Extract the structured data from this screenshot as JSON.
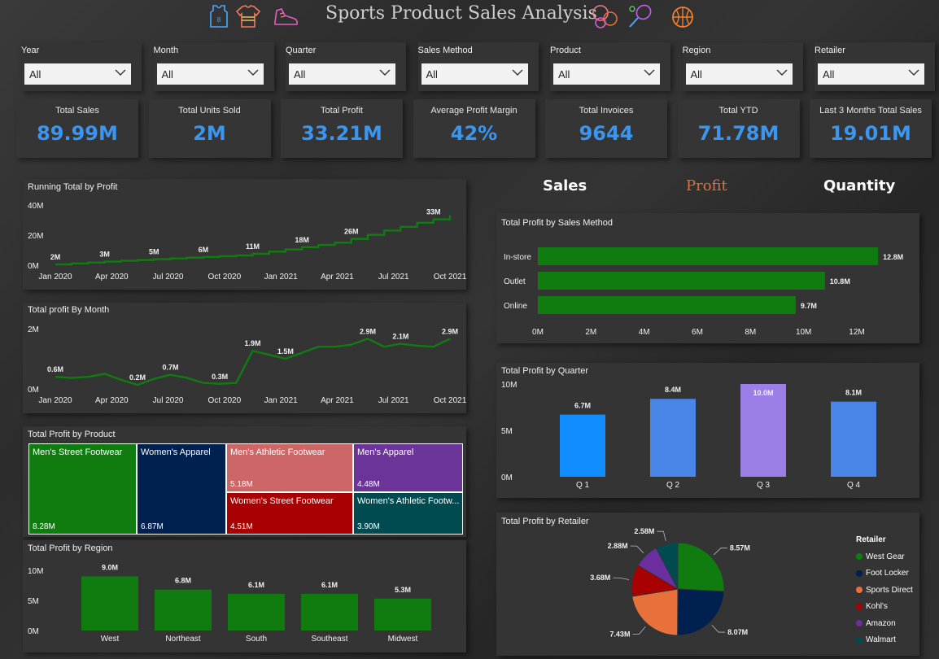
{
  "header": {
    "title": "Sports Product Sales Analysis",
    "icons": [
      "jersey-icon",
      "shirt-icon",
      "sneaker-icon",
      "sports-balls-icon",
      "tennis-racket-icon",
      "basketball-icon"
    ]
  },
  "slicers": [
    {
      "label": "Year",
      "value": "All"
    },
    {
      "label": "Month",
      "value": "All"
    },
    {
      "label": "Quarter",
      "value": "All"
    },
    {
      "label": "Sales Method",
      "value": "All"
    },
    {
      "label": "Product",
      "value": "All"
    },
    {
      "label": "Region",
      "value": "All"
    },
    {
      "label": "Retailer",
      "value": "All"
    }
  ],
  "kpis": [
    {
      "title": "Total Sales",
      "value": "89.99M"
    },
    {
      "title": "Total Units Sold",
      "value": "2M"
    },
    {
      "title": "Total Profit",
      "value": "33.21M"
    },
    {
      "title": "Average Profit Margin",
      "value": "42%"
    },
    {
      "title": "Total Invoices",
      "value": "9644"
    },
    {
      "title": "Total YTD",
      "value": "71.78M"
    },
    {
      "title": "Last 3 Months Total Sales",
      "value": "19.01M"
    }
  ],
  "tabs": {
    "sales": "Sales",
    "profit": "Profit",
    "quantity": "Quantity"
  },
  "colors": {
    "kpi_value": "#3a96f0",
    "green": "#107c10",
    "accent_profit": "#e0703a"
  },
  "chart_data": [
    {
      "id": "running",
      "type": "line",
      "title": "Running Total by Profit",
      "x_ticks": [
        "Jan 2020",
        "Apr 2020",
        "Jul 2020",
        "Oct 2020",
        "Jan 2021",
        "Apr 2021",
        "Jul 2021",
        "Oct 2021"
      ],
      "y_ticks": [
        "0M",
        "20M",
        "40M"
      ],
      "ylim": [
        0,
        40
      ],
      "values": [
        0.6,
        1.2,
        1.8,
        2.4,
        3,
        3.5,
        4,
        4.5,
        5,
        5.5,
        6,
        6.5,
        7.6,
        9,
        10.5,
        12,
        13.5,
        15,
        17.5,
        20.2,
        23,
        25.5,
        28.2,
        30.5,
        33.21
      ],
      "labels": [
        {
          "i": 0,
          "text": "2M"
        },
        {
          "i": 3,
          "text": "3M"
        },
        {
          "i": 6,
          "text": "5M"
        },
        {
          "i": 9,
          "text": "6M"
        },
        {
          "i": 12,
          "text": "11M"
        },
        {
          "i": 15,
          "text": "18M"
        },
        {
          "i": 18,
          "text": "26M"
        },
        {
          "i": 23,
          "text": "33M"
        }
      ]
    },
    {
      "id": "monthly",
      "type": "line",
      "title": "Total profit By Month",
      "x_ticks": [
        "Jan 2020",
        "Apr 2020",
        "Jul 2020",
        "Oct 2020",
        "Jan 2021",
        "Apr 2021",
        "Jul 2021",
        "Oct 2021"
      ],
      "y_ticks": [
        "0M",
        "2M"
      ],
      "ylim": [
        0,
        3
      ],
      "values": [
        0.6,
        0.55,
        0.6,
        0.75,
        0.45,
        0.2,
        0.5,
        0.7,
        0.55,
        0.3,
        0.25,
        0.3,
        1.9,
        1.7,
        1.5,
        1.8,
        2.1,
        2.1,
        2.2,
        2.5,
        2.1,
        2.25,
        2.15,
        2.1,
        2.5
      ],
      "labels": [
        {
          "i": 0,
          "text": "0.6M"
        },
        {
          "i": 5,
          "text": "0.2M"
        },
        {
          "i": 7,
          "text": "0.7M"
        },
        {
          "i": 10,
          "text": "0.3M"
        },
        {
          "i": 12,
          "text": "1.9M"
        },
        {
          "i": 14,
          "text": "1.5M"
        },
        {
          "i": 19,
          "text": "2.9M"
        },
        {
          "i": 21,
          "text": "2.1M"
        },
        {
          "i": 24,
          "text": "2.9M"
        }
      ]
    },
    {
      "id": "method",
      "type": "bar",
      "title": "Total Profit by Sales Method",
      "categories": [
        "In-store",
        "Outlet",
        "Online"
      ],
      "values": [
        12.8,
        10.8,
        9.7
      ],
      "data_labels": [
        "12.8M",
        "10.8M",
        "9.7M"
      ],
      "x_ticks": [
        "0M",
        "2M",
        "4M",
        "6M",
        "8M",
        "10M",
        "12M"
      ],
      "xlim": [
        0,
        12
      ]
    },
    {
      "id": "quarter",
      "type": "bar",
      "title": "Total Profit by Quarter",
      "categories": [
        "Q 1",
        "Q 2",
        "Q 3",
        "Q 4"
      ],
      "values": [
        6.7,
        8.4,
        10.0,
        8.1
      ],
      "data_labels": [
        "6.7M",
        "8.4M",
        "10.0M",
        "8.1M"
      ],
      "colors": [
        "#118dff",
        "#4a86e8",
        "#9b7fe6",
        "#4a86e8"
      ],
      "y_ticks": [
        "0M",
        "5M",
        "10M"
      ],
      "ylim": [
        0,
        10
      ]
    },
    {
      "id": "product",
      "type": "heatmap",
      "title": "Total Profit by Product",
      "items": [
        {
          "name": "Men's Street Footwear",
          "value": "8.28M",
          "color": "#107c10"
        },
        {
          "name": "Women's Apparel",
          "value": "6.87M",
          "color": "#002050"
        },
        {
          "name": "Men's Athletic Footwear",
          "value": "5.18M",
          "color": "#cd6666"
        },
        {
          "name": "Men's Apparel",
          "value": "4.48M",
          "color": "#6b3499"
        },
        {
          "name": "Women's Street Footwear",
          "value": "4.51M",
          "color": "#a80000"
        },
        {
          "name": "Women's Athletic Footw...",
          "value": "3.90M",
          "color": "#004b50"
        }
      ]
    },
    {
      "id": "region",
      "type": "bar",
      "title": "Total Profit by Region",
      "categories": [
        "West",
        "Northeast",
        "South",
        "Southeast",
        "Midwest"
      ],
      "values": [
        9.0,
        6.8,
        6.1,
        6.1,
        5.3
      ],
      "data_labels": [
        "9.0M",
        "6.8M",
        "6.1M",
        "6.1M",
        "5.3M"
      ],
      "y_ticks": [
        "0M",
        "5M",
        "10M"
      ],
      "ylim": [
        0,
        10
      ]
    },
    {
      "id": "retailer",
      "type": "pie",
      "title": "Total Profit by Retailer",
      "legend_title": "Retailer",
      "slices": [
        {
          "name": "West Gear",
          "value": 8.57,
          "label": "8.57M",
          "color": "#107c10"
        },
        {
          "name": "Foot Locker",
          "value": 8.07,
          "label": "8.07M",
          "color": "#002050"
        },
        {
          "name": "Sports Direct",
          "value": 7.43,
          "label": "7.43M",
          "color": "#e8703a"
        },
        {
          "name": "Kohl's",
          "value": 3.68,
          "label": "3.68M",
          "color": "#a80000"
        },
        {
          "name": "Amazon",
          "value": 2.88,
          "label": "2.88M",
          "color": "#6b2fa0"
        },
        {
          "name": "Walmart",
          "value": 2.58,
          "label": "2.58M",
          "color": "#004b50"
        }
      ]
    }
  ]
}
